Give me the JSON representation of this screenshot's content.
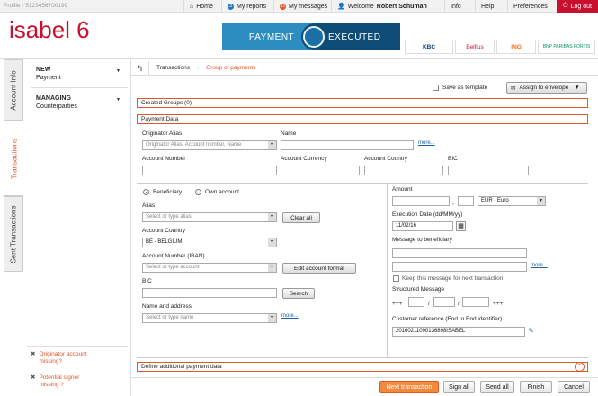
{
  "topbar": {
    "profile": "Profile - 5123456700199",
    "nav": {
      "home": "Home",
      "reports": "My reports",
      "reports_badge": "3",
      "messages": "My messages",
      "messages_badge": "12",
      "welcome": "Welcome",
      "user": "Robert Schuman",
      "info": "Info",
      "help": "Help",
      "preferences": "Preferences",
      "logout": "Log out"
    }
  },
  "header": {
    "logo": "isabel 6",
    "mode_left": "PAYMENT",
    "mode_right": "EXECUTED",
    "banks": [
      "KBC",
      "Belfius",
      "ING",
      "BNP PARIBAS FORTIS"
    ]
  },
  "vtabs": [
    "Account Info",
    "Transactions",
    "Sent Transactions"
  ],
  "menu": [
    {
      "title": "NEW",
      "sub": "Payment"
    },
    {
      "title": "MANAGING",
      "sub": "Counterparties"
    }
  ],
  "help_links": [
    "Originator account missing?",
    "Potential signer missing ?"
  ],
  "breadcrumb": [
    "Transactions",
    "Group of payments"
  ],
  "actions": {
    "save_template": "Save as template",
    "assign_envelope": "Assign to envelope"
  },
  "sections": {
    "created_groups": "Created Groups (0)",
    "payment_data": "Payment Data",
    "additional": "Define additional payment data"
  },
  "originator": {
    "alias_label": "Originator Alias",
    "alias_placeholder": "Originator Alias, Account number, Name",
    "name_label": "Name",
    "more": "more...",
    "acct_number_label": "Account Number",
    "currency_label": "Account Currency",
    "country_label": "Account Country",
    "bic_label": "BIC"
  },
  "beneficiary": {
    "radio_beneficiary": "Beneficiary",
    "radio_own": "Own account",
    "alias_label": "Alias",
    "alias_placeholder": "Select or type alias",
    "clear_all": "Clear all",
    "country_label": "Account Country",
    "country_value": "BE - BELGIUM",
    "iban_label": "Account Number (IBAN)",
    "iban_placeholder": "Select or type account",
    "edit_format": "Edit account format",
    "bic_label": "BIC",
    "search": "Search",
    "name_label": "Name and address",
    "name_placeholder": "Select or type name",
    "more": "more..."
  },
  "payment": {
    "amount_label": "Amount",
    "currency": "EUR - Euro",
    "exec_label": "Execution Date (dd/MM/yy)",
    "exec_value": "11/02/16",
    "message_label": "Message to beneficiary",
    "more": "more...",
    "keep_message": "Keep this message for next transaction",
    "structured_label": "Structured Message",
    "plus": "+++",
    "slash": "/",
    "customer_ref_label": "Customer reference (End to End identifier)",
    "customer_ref_value": "20160211090136898ISABEL"
  },
  "footer": {
    "next": "Next transaction",
    "sign_all": "Sign all",
    "send_all": "Send all",
    "finish": "Finish",
    "cancel": "Cancel"
  },
  "colors": {
    "accent": "#e2572a",
    "brand_red": "#c8102e",
    "blue": "#2b8dc0",
    "dark_blue": "#0e4d78"
  }
}
